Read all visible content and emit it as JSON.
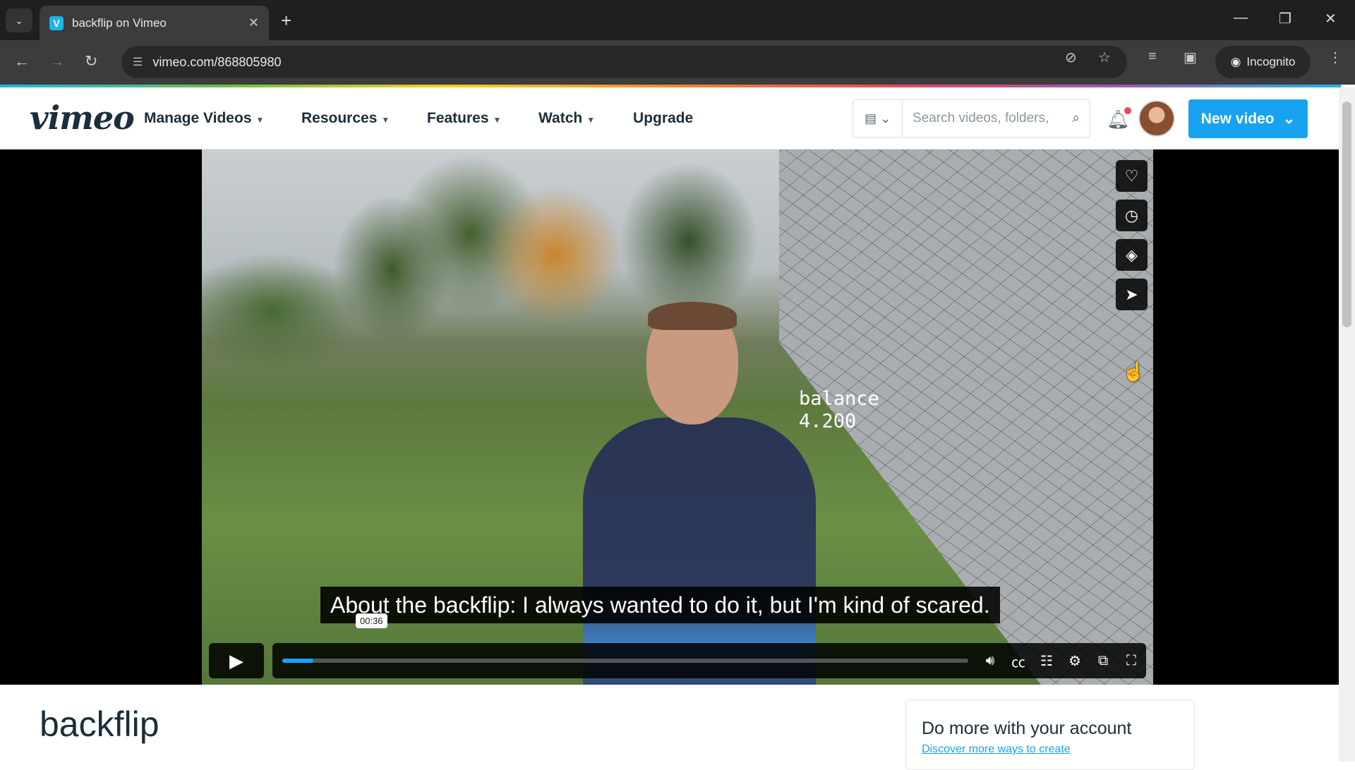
{
  "browser": {
    "tab_title": "backflip on Vimeo",
    "tab_close": "✕",
    "new_tab": "+",
    "url": "vimeo.com/868805980",
    "incognito_label": "Incognito",
    "window_controls": [
      "—",
      "❐",
      "✕"
    ]
  },
  "header": {
    "logo": "vimeo",
    "menu": [
      {
        "label": "Manage Videos",
        "has_dropdown": true
      },
      {
        "label": "Resources",
        "has_dropdown": true
      },
      {
        "label": "Features",
        "has_dropdown": true
      },
      {
        "label": "Watch",
        "has_dropdown": true
      },
      {
        "label": "Upgrade",
        "has_dropdown": false
      }
    ],
    "search_placeholder": "Search videos, folders,",
    "new_video_label": "New video"
  },
  "player": {
    "hud_line1": "balance",
    "hud_line2": "4.200",
    "caption": "About the backflip: I always wanted to do it, but I'm kind of scared.",
    "timecode": "00:36",
    "progress_fraction": 0.045,
    "side_buttons": [
      "heart-icon",
      "clock-icon",
      "layers-icon",
      "share-icon"
    ]
  },
  "page": {
    "video_title": "backflip",
    "promo_heading": "Do more with your account",
    "promo_link": "Discover more ways to create"
  },
  "colors": {
    "accent": "#17a3f0",
    "brand_dark": "#1a2e3b"
  }
}
